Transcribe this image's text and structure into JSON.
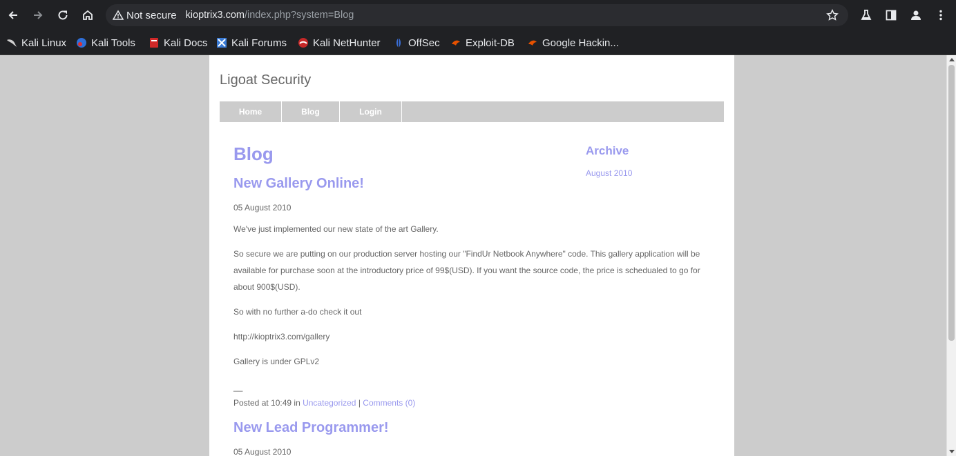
{
  "browser": {
    "security_label": "Not secure",
    "url_host": "kioptrix3.com",
    "url_path": "/index.php?system=Blog",
    "icons": [
      "back-icon",
      "forward-icon",
      "reload-icon",
      "home-icon",
      "warning-icon",
      "star-icon",
      "labs-icon",
      "side-panel-icon",
      "profile-icon",
      "menu-icon"
    ]
  },
  "bookmarks": [
    {
      "label": "Kali Linux",
      "icon": "kali-dragon-icon"
    },
    {
      "label": "Kali Tools",
      "icon": "kali-tools-icon"
    },
    {
      "label": "Kali Docs",
      "icon": "kali-docs-icon"
    },
    {
      "label": "Kali Forums",
      "icon": "kali-forums-icon"
    },
    {
      "label": "Kali NetHunter",
      "icon": "nethunter-icon"
    },
    {
      "label": "OffSec",
      "icon": "offsec-icon"
    },
    {
      "label": "Exploit-DB",
      "icon": "exploit-db-icon"
    },
    {
      "label": "Google Hackin...",
      "icon": "ghdb-icon"
    }
  ],
  "site": {
    "title": "Ligoat Security",
    "nav": [
      "Home",
      "Blog",
      "Login"
    ]
  },
  "blog": {
    "heading": "Blog",
    "posts": [
      {
        "title": "New Gallery Online!",
        "date": "05 August 2010",
        "paragraphs": [
          "We've just implemented our new state of the art Gallery.",
          "So secure we are putting on our production server hosting our \"FindUr Netbook Anywhere\" code. This gallery application will be available for purchase soon at the introductory price of 99$(USD). If you want the source code, the price is schedualed to go for about 900$(USD).",
          "So with no further a-do check it out",
          "http://kioptrix3.com/gallery",
          "Gallery is under GPLv2"
        ],
        "signature": "__",
        "posted_prefix": "Posted at 10:49 in",
        "category": "Uncategorized",
        "separator": "|",
        "comments": "Comments (0)"
      },
      {
        "title": "New Lead Programmer!",
        "date": "05 August 2010"
      }
    ]
  },
  "archive": {
    "heading": "Archive",
    "months": [
      "August 2010"
    ]
  },
  "colors": {
    "accent": "#9999ee",
    "text": "#666666",
    "nav_bg": "#cccccc",
    "browser_bg": "#202124"
  }
}
